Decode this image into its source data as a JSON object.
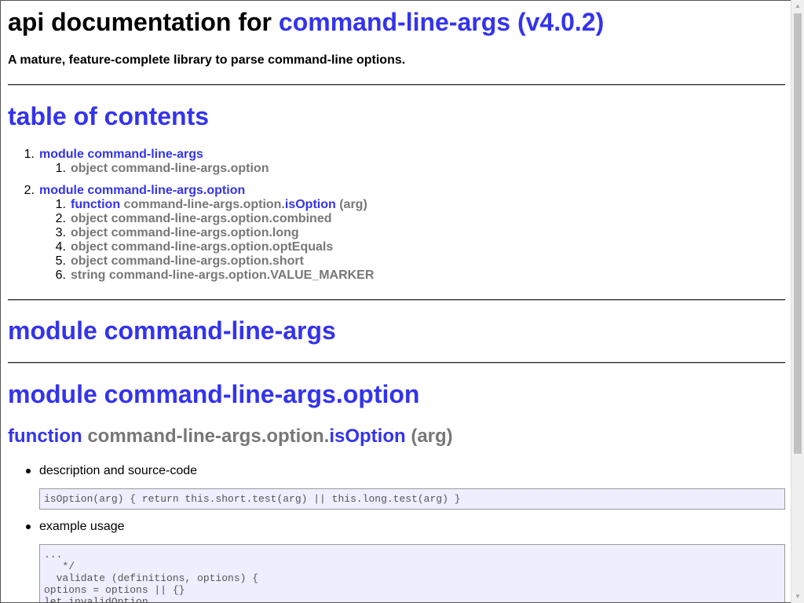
{
  "header": {
    "title_prefix": "api documentation for",
    "title_link": "command-line-args (v4.0.2)",
    "subtitle": "A mature, feature-complete library to parse command-line options."
  },
  "toc": {
    "heading": "table of contents",
    "items": [
      {
        "num": "1.",
        "label": "module command-line-args",
        "children": [
          {
            "num": "1.",
            "kind": "object",
            "name": "command-line-args.option",
            "link": "",
            "suffix": ""
          }
        ]
      },
      {
        "num": "2.",
        "label": "module command-line-args.option",
        "children": [
          {
            "num": "1.",
            "kind": "function",
            "name": "command-line-args.option.",
            "link": "isOption",
            "suffix": " (arg)"
          },
          {
            "num": "2.",
            "kind": "object",
            "name": "command-line-args.option.combined",
            "link": "",
            "suffix": ""
          },
          {
            "num": "3.",
            "kind": "object",
            "name": "command-line-args.option.long",
            "link": "",
            "suffix": ""
          },
          {
            "num": "4.",
            "kind": "object",
            "name": "command-line-args.option.optEquals",
            "link": "",
            "suffix": ""
          },
          {
            "num": "5.",
            "kind": "object",
            "name": "command-line-args.option.short",
            "link": "",
            "suffix": ""
          },
          {
            "num": "6.",
            "kind": "string",
            "name": "command-line-args.option.VALUE_MARKER",
            "link": "",
            "suffix": ""
          }
        ]
      }
    ]
  },
  "sections": {
    "module1_heading": "module command-line-args",
    "module2_heading": "module command-line-args.option"
  },
  "function_section": {
    "kind": "function",
    "name_prefix": "command-line-args.option.",
    "name_link": "isOption",
    "args": "(arg)",
    "bullet1": "description and source-code",
    "source_code": "isOption(arg) { return this.short.test(arg) || this.long.test(arg) }",
    "bullet2": "example usage",
    "example_code": "...\n   */\n  validate (definitions, options) {\noptions = options || {}\nlet invalidOption"
  },
  "colors": {
    "link": "#3333ee",
    "muted": "#777777",
    "code_bg": "#eeeeff"
  }
}
